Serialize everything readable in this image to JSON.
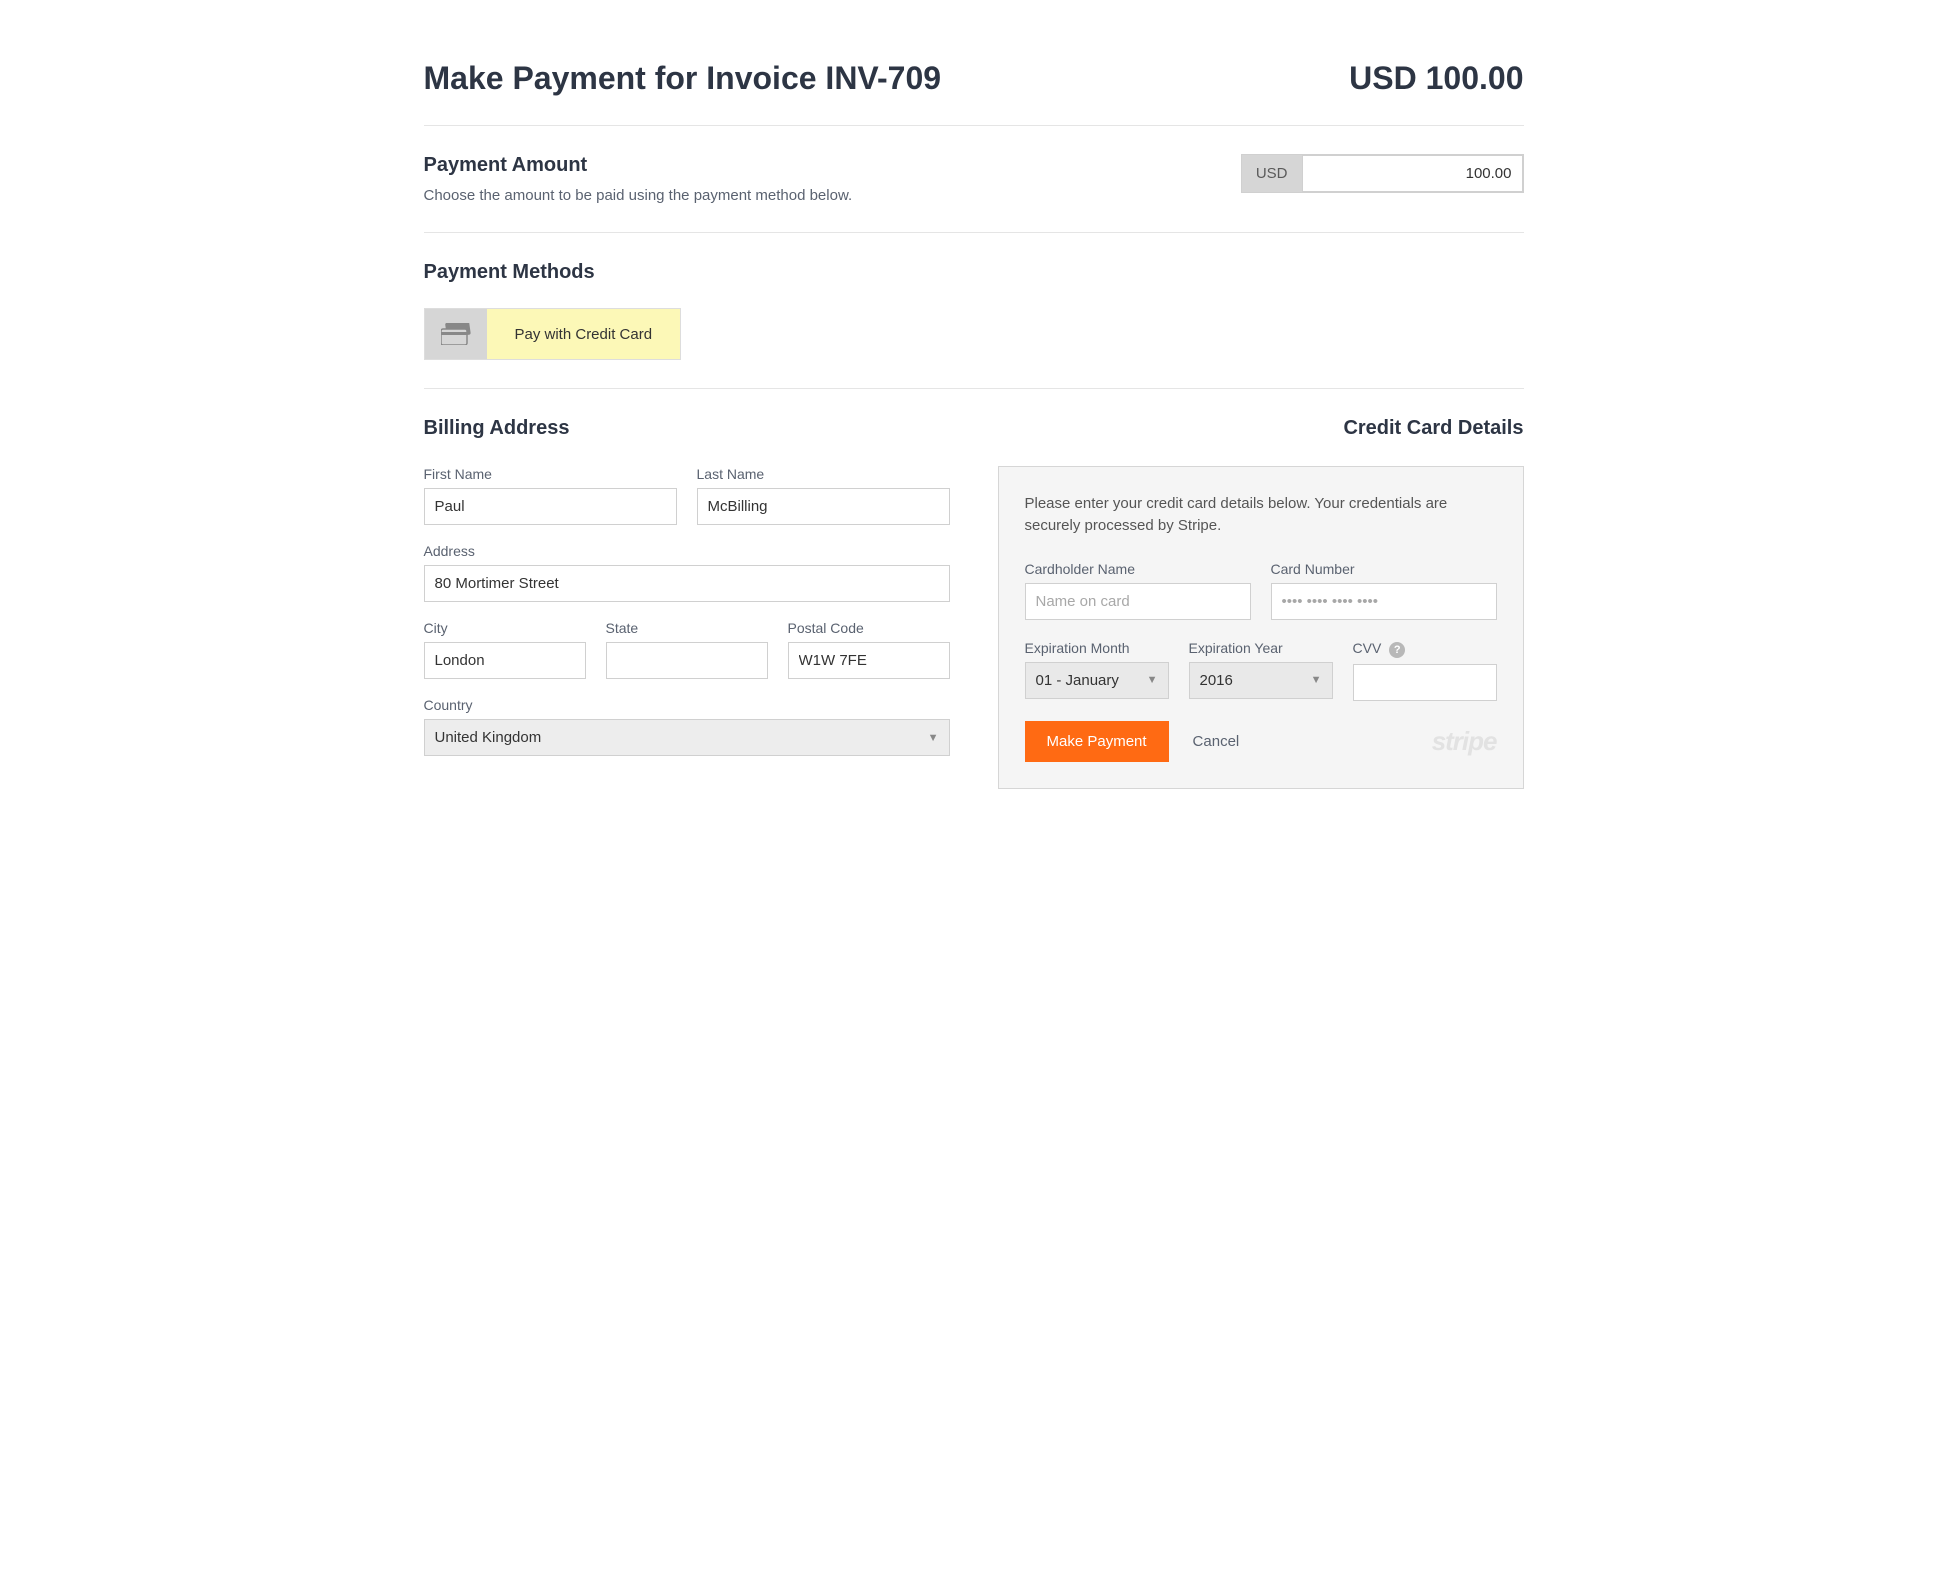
{
  "header": {
    "title": "Make Payment for Invoice INV-709",
    "amount": "USD 100.00"
  },
  "payment_amount": {
    "heading": "Payment Amount",
    "description": "Choose the amount to be paid using the payment method below.",
    "currency": "USD",
    "value": "100.00"
  },
  "payment_methods": {
    "heading": "Payment Methods",
    "option_label": "Pay with Credit Card"
  },
  "billing": {
    "heading": "Billing Address",
    "first_name_label": "First Name",
    "first_name": "Paul",
    "last_name_label": "Last Name",
    "last_name": "McBilling",
    "address_label": "Address",
    "address": "80 Mortimer Street",
    "city_label": "City",
    "city": "London",
    "state_label": "State",
    "state": "",
    "postal_label": "Postal Code",
    "postal": "W1W 7FE",
    "country_label": "Country",
    "country": "United Kingdom"
  },
  "card": {
    "heading": "Credit Card Details",
    "hint": "Please enter your credit card details below. Your credentials are securely processed by Stripe.",
    "cardholder_label": "Cardholder Name",
    "cardholder_placeholder": "Name on card",
    "number_label": "Card Number",
    "number_placeholder": "•••• •••• •••• ••••",
    "exp_month_label": "Expiration Month",
    "exp_month": "01 - January",
    "exp_year_label": "Expiration Year",
    "exp_year": "2016",
    "cvv_label": "CVV",
    "submit_label": "Make Payment",
    "cancel_label": "Cancel",
    "processor": "stripe"
  }
}
